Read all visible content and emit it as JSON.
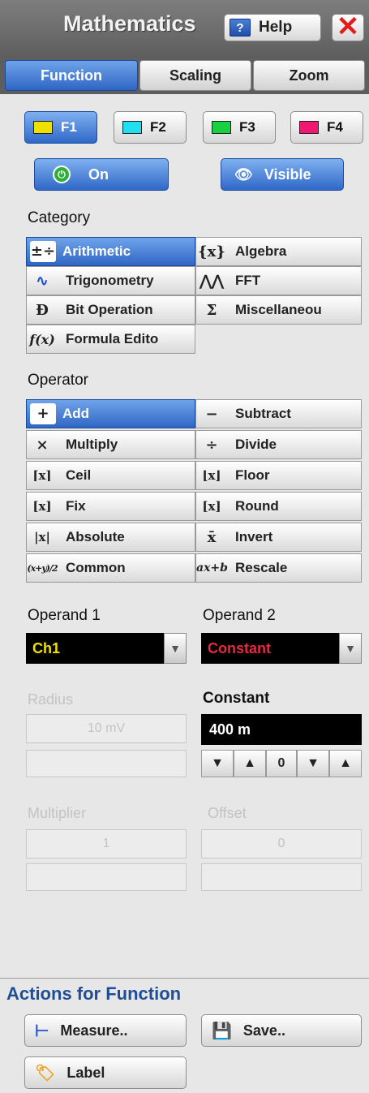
{
  "header": {
    "title": "Mathematics",
    "help_label": "Help",
    "help_icon": "help-book-icon"
  },
  "tabs": [
    {
      "label": "Function",
      "active": true
    },
    {
      "label": "Scaling",
      "active": false
    },
    {
      "label": "Zoom",
      "active": false
    }
  ],
  "functions": [
    {
      "label": "F1",
      "color": "#f0e000",
      "selected": true
    },
    {
      "label": "F2",
      "color": "#20e0f0",
      "selected": false
    },
    {
      "label": "F3",
      "color": "#18d040",
      "selected": false
    },
    {
      "label": "F4",
      "color": "#f01870",
      "selected": false
    }
  ],
  "toggles": {
    "on_label": "On",
    "visible_label": "Visible"
  },
  "category": {
    "title": "Category",
    "items": [
      {
        "label": "Arithmetic",
        "icon": "±÷",
        "active": true
      },
      {
        "label": "Algebra",
        "icon": "{x}",
        "active": false
      },
      {
        "label": "Trigonometry",
        "icon": "∿",
        "active": false
      },
      {
        "label": "FFT",
        "icon": "⋀⋀",
        "active": false
      },
      {
        "label": "Bit Operation",
        "icon": "Ð",
        "active": false
      },
      {
        "label": "Miscellaneou",
        "icon": "Σ",
        "active": false
      },
      {
        "label": "Formula Edito",
        "icon": "f(x)",
        "active": false
      }
    ]
  },
  "operator": {
    "title": "Operator",
    "items": [
      {
        "label": "Add",
        "icon": "+",
        "active": true
      },
      {
        "label": "Subtract",
        "icon": "−",
        "active": false
      },
      {
        "label": "Multiply",
        "icon": "×",
        "active": false
      },
      {
        "label": "Divide",
        "icon": "÷",
        "active": false
      },
      {
        "label": "Ceil",
        "icon": "⌈x⌉",
        "active": false
      },
      {
        "label": "Floor",
        "icon": "⌊x⌋",
        "active": false
      },
      {
        "label": "Fix",
        "icon": "[x]",
        "active": false
      },
      {
        "label": "Round",
        "icon": "[x]",
        "active": false
      },
      {
        "label": "Absolute",
        "icon": "|x|",
        "active": false
      },
      {
        "label": "Invert",
        "icon": "x̄",
        "active": false
      },
      {
        "label": "Common",
        "icon": "(x+y)/2",
        "active": false
      },
      {
        "label": "Rescale",
        "icon": "ax+b",
        "active": false
      }
    ]
  },
  "operand1": {
    "title": "Operand 1",
    "value": "Ch1",
    "color": "#f0e000"
  },
  "operand2": {
    "title": "Operand 2",
    "value": "Constant",
    "color": "#e8283c"
  },
  "radius": {
    "title": "Radius",
    "value": "10 mV"
  },
  "constant": {
    "title": "Constant",
    "value": "400 m",
    "step_value": "0"
  },
  "multiplier": {
    "title": "Multiplier",
    "value": "1"
  },
  "offset": {
    "title": "Offset",
    "value": "0"
  },
  "actions": {
    "title": "Actions for Function",
    "measure_label": "Measure..",
    "save_label": "Save..",
    "label_label": "Label"
  }
}
